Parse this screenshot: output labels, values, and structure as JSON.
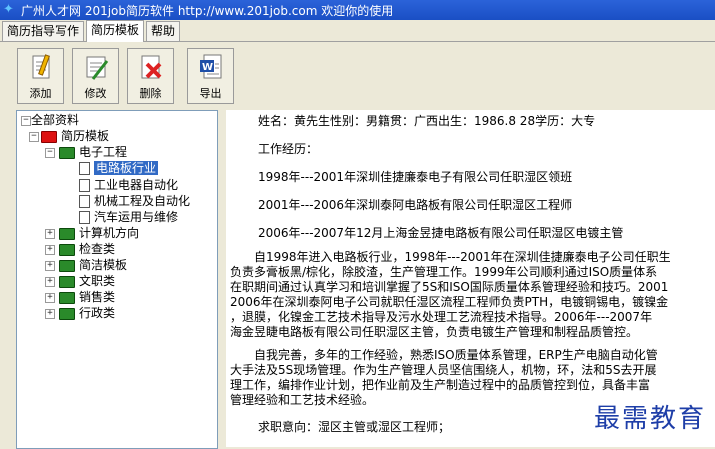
{
  "window": {
    "title": "广州人才网 201job简历软件 http://www.201job.com 欢迎你的使用"
  },
  "tabs": [
    {
      "label": "简历指导写作"
    },
    {
      "label": "简历模板"
    },
    {
      "label": "帮助"
    }
  ],
  "toolbar": {
    "add": "添加",
    "edit": "修改",
    "delete": "删除",
    "export": "导出"
  },
  "tree": {
    "root": "全部资料",
    "template": "简历模板",
    "electronics": "电子工程",
    "items": [
      "电路板行业",
      "工业电器自动化",
      "机械工程及自动化",
      "汽车运用与维修"
    ],
    "categories": [
      "计算机方向",
      "检查类",
      "简洁模板",
      "文职类",
      "销售类",
      "行政类"
    ]
  },
  "resume": {
    "header": "姓名：黄先生性别：男籍贯：广西出生：1986.8 28学历：大专",
    "exp_title": "工作经历：",
    "exp1": "1998年---2001年深圳佳捷廉泰电子有限公司任职湿区领班",
    "exp2": "2001年---2006年深圳泰阿电路板有限公司任职湿区工程师",
    "exp3": "2006年---2007年12月上海金昱捷电路板有限公司任职湿区电镀主管",
    "para1_l1": "　　自1998年进入电路板行业，1998年---2001年在深圳佳捷廉泰电子公司任职生",
    "para1_l2": "负责多膏板黑/棕化，除胶渣，生产管理工作。1999年公司顺利通过ISO质量体系",
    "para1_l3": "在职期间通过认真学习和培训掌握了5S和ISO国际质量体系管理经验和技巧。2001",
    "para1_l4": "2006年在深圳泰阿电子公司就职任湿区流程工程师负责PTH，电镀铜锡电，镀镍金",
    "para1_l5": "，退膜，化镍金工艺技术指导及污水处理工艺流程技术指导。2006年---2007年",
    "para1_l6": "海金昱睫电路板有限公司任职湿区主管，负责电镀生产管理和制程品质管控。",
    "para2_l1": "　　自我完善，多年的工作经验，熟悉ISO质量体系管理，ERP生产电脑自动化管",
    "para2_l2": "大手法及5S现场管理。作为生产管理人员坚信围绕人，机物，环，法和5S去开展",
    "para2_l3": "理工作，编排作业计划，把作业前及生产制造过程中的品质管控到位，具备丰富",
    "para2_l4": "管理经验和工艺技术经验。",
    "intent": "求职意向：湿区主管或湿区工程师；"
  },
  "watermark": "最需教育"
}
